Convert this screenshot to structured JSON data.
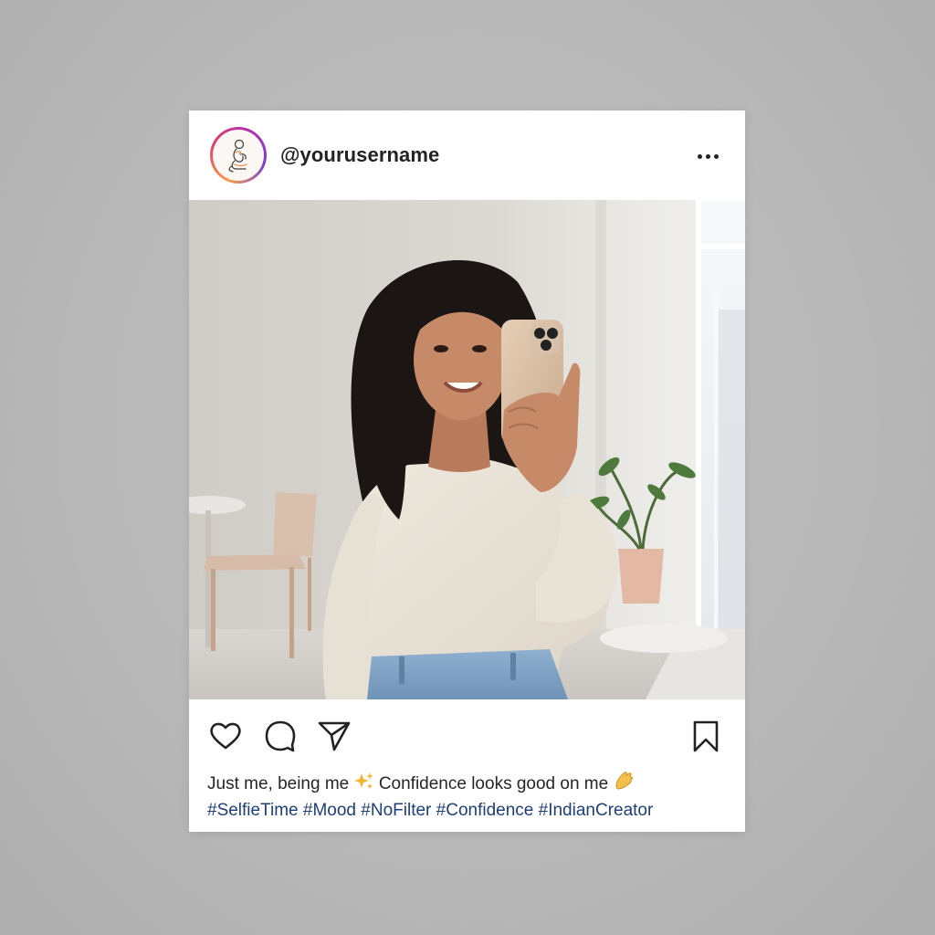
{
  "post": {
    "username": "@yourusername",
    "caption_text_1": "Just me, being me",
    "caption_text_2": "Confidence looks good on me",
    "hashtags": [
      "#SelfieTime",
      "#Mood",
      "#NoFilter",
      "#Confidence",
      "#IndianCreator"
    ]
  },
  "icons": {
    "avatar": "sketch-figure-avatar",
    "more": "more-horizontal-icon",
    "like": "heart-icon",
    "comment": "comment-bubble-icon",
    "share": "paper-plane-icon",
    "save": "bookmark-icon",
    "sparkle": "sparkles-emoji",
    "hand": "pinched-fingers-emoji"
  },
  "colors": {
    "background": "#b9b9b9",
    "card": "#ffffff",
    "hashtag": "#1f3f75",
    "text": "#262626",
    "avatar_ring_start": "#f6a04d",
    "avatar_ring_end": "#b531a8"
  }
}
